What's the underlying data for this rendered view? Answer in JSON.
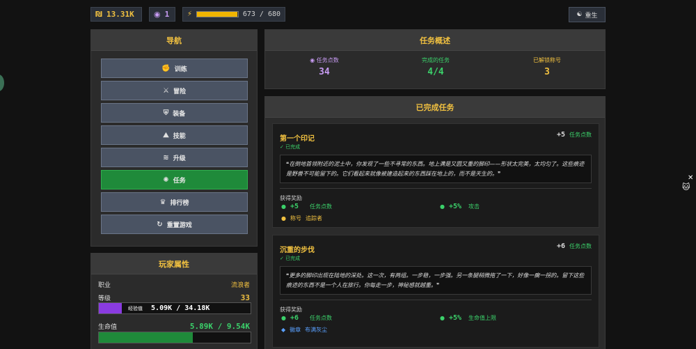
{
  "topbar": {
    "gold": "13.31K",
    "quest_points": "1",
    "energy_current": "673",
    "energy_sep": "/",
    "energy_max": "680",
    "energy_fraction": 0.99,
    "rebirth_label": "重生"
  },
  "nav": {
    "title": "导航",
    "items": [
      {
        "label": "训练",
        "icon": "muscle-icon"
      },
      {
        "label": "冒险",
        "icon": "swords-icon"
      },
      {
        "label": "装备",
        "icon": "armor-icon"
      },
      {
        "label": "技能",
        "icon": "skills-icon"
      },
      {
        "label": "升级",
        "icon": "upgrade-icon"
      },
      {
        "label": "任务",
        "icon": "quest-icon"
      },
      {
        "label": "排行榜",
        "icon": "trophy-icon"
      },
      {
        "label": "重置游戏",
        "icon": "reset-icon"
      }
    ],
    "active_index": 5
  },
  "stats": {
    "title": "玩家属性",
    "class_label": "职业",
    "class_value": "流浪者",
    "level_label": "等级",
    "level_value": "33",
    "xp_label": "经验值",
    "xp_current": "5.09K",
    "xp_sep": "/",
    "xp_max": "34.18K",
    "xp_fraction": 0.15,
    "hp_label": "生命值",
    "hp_current": "5.89K",
    "hp_sep": "/",
    "hp_max": "9.54K",
    "hp_fraction": 0.62
  },
  "overview": {
    "title": "任务概述",
    "points_label": "任务点数",
    "points_value": "34",
    "completed_label": "完成的任务",
    "completed_value": "4/4",
    "titles_label": "已解锁称号",
    "titles_value": "3"
  },
  "completed": {
    "title": "已完成任务",
    "quests": [
      {
        "name": "第一个印记",
        "status": "✓ 已完成",
        "points": "+5",
        "points_label": "任务点数",
        "quote": "在倒地首领附近的泥土中，你发现了一些不寻常的东西。地上满是又圆又重的脚印——形状太完美，太均匀了。这些痕迹是野兽不可能留下的。它们看起来就像被建造起来的东西踩在地上的，而不是天生的。",
        "rewards_label": "获得奖励",
        "rewards": [
          {
            "amount": "+5",
            "label": "任务点数"
          },
          {
            "amount": "+5%",
            "label": "攻击"
          },
          {
            "amount": "称号",
            "label": "追踪者"
          }
        ]
      },
      {
        "name": "沉重的步伐",
        "status": "✓ 已完成",
        "points": "+6",
        "points_label": "任务点数",
        "quote": "更多的脚印出现在陆地的深处。这一次，有两组。一步稳，一步强。另一条腿稍微拖了一下，好像一瘸一拐的。留下这些痕迹的东西不是一个人在旅行。你每走一步，神秘感就越重。",
        "rewards_label": "获得奖励",
        "rewards": [
          {
            "amount": "+6",
            "label": "任务点数"
          },
          {
            "amount": "+5%",
            "label": "生命值上限"
          },
          {
            "amount": "徽章",
            "label": "布满灰尘"
          }
        ]
      }
    ]
  },
  "colors": {
    "accent": "#f0c040",
    "active_nav": "#1f8a3a",
    "xp": "#8a3be0",
    "success": "#3bd06a"
  }
}
